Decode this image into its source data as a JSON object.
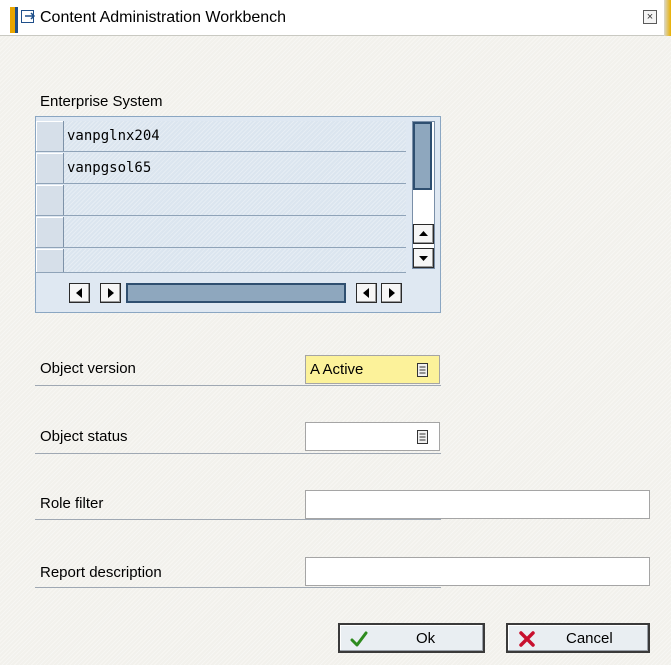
{
  "window": {
    "title": "Content Administration Workbench",
    "close_glyph": "×",
    "icon": "window-icon",
    "accent_color": "#e8a500"
  },
  "enterprise_system": {
    "label": "Enterprise System",
    "rows": [
      "vanpglnx204",
      "vanpgsol65",
      "",
      "",
      ""
    ],
    "scroll_thumb_color": "#8ea7be",
    "row_background": "#dbe5ef"
  },
  "object_version": {
    "label": "Object version",
    "value": "A Active",
    "highlight_color": "#fcf29a"
  },
  "object_status": {
    "label": "Object status",
    "value": ""
  },
  "role_filter": {
    "label": "Role filter",
    "value": ""
  },
  "report_description": {
    "label": "Report description",
    "value": ""
  },
  "buttons": {
    "ok": {
      "label": "Ok",
      "icon": "check-icon",
      "color": "#2e8b1e"
    },
    "cancel": {
      "label": "Cancel",
      "icon": "cross-icon",
      "color": "#c8102e"
    }
  }
}
